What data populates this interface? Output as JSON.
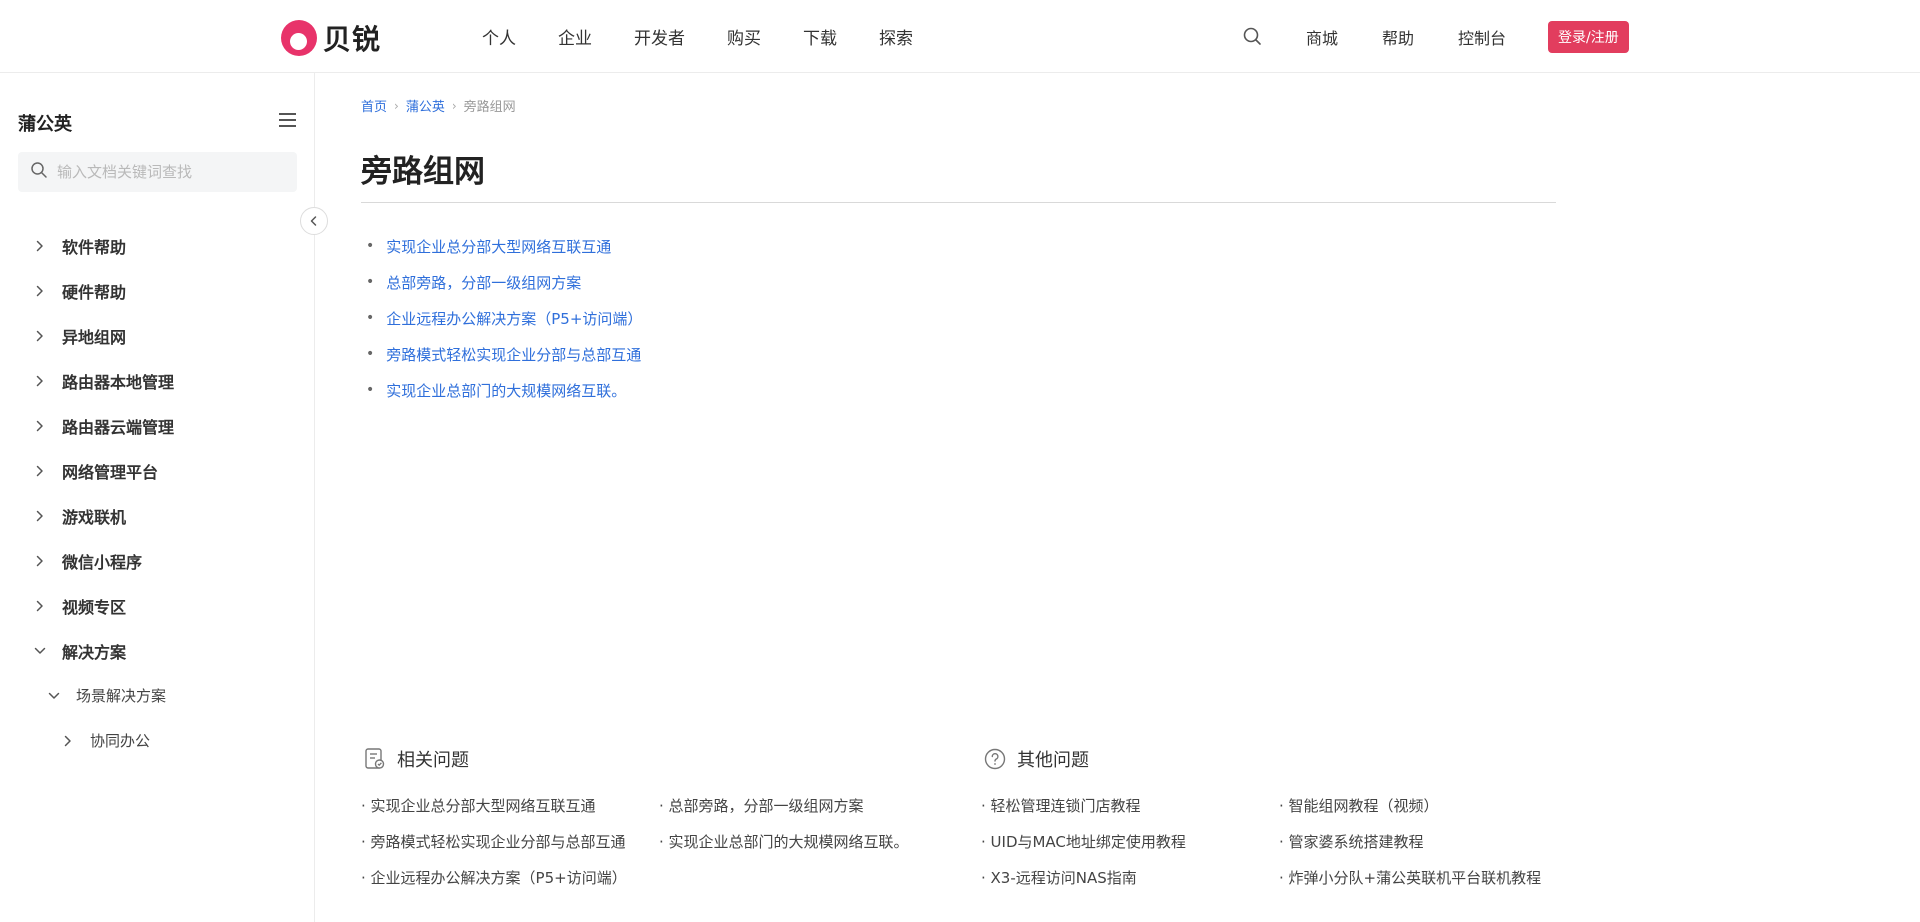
{
  "brand": {
    "name": "贝锐",
    "color": "#e8336a"
  },
  "nav": {
    "items": [
      "个人",
      "企业",
      "开发者",
      "购买",
      "下载",
      "探索"
    ],
    "right": [
      "商城",
      "帮助",
      "控制台"
    ],
    "login": "登录/注册",
    "login_color": "#e23d5e"
  },
  "sidebar": {
    "title": "蒲公英",
    "search_placeholder": "输入文档关键词查找",
    "tree": [
      {
        "label": "软件帮助",
        "level": 0,
        "expanded": false
      },
      {
        "label": "硬件帮助",
        "level": 0,
        "expanded": false
      },
      {
        "label": "异地组网",
        "level": 0,
        "expanded": false
      },
      {
        "label": "路由器本地管理",
        "level": 0,
        "expanded": false
      },
      {
        "label": "路由器云端管理",
        "level": 0,
        "expanded": false
      },
      {
        "label": "网络管理平台",
        "level": 0,
        "expanded": false
      },
      {
        "label": "游戏联机",
        "level": 0,
        "expanded": false
      },
      {
        "label": "微信小程序",
        "level": 0,
        "expanded": false
      },
      {
        "label": "视频专区",
        "level": 0,
        "expanded": false
      },
      {
        "label": "解决方案",
        "level": 0,
        "expanded": true
      },
      {
        "label": "场景解决方案",
        "level": 1,
        "expanded": true
      },
      {
        "label": "协同办公",
        "level": 2,
        "expanded": false
      }
    ]
  },
  "breadcrumb": {
    "home": "首页",
    "parent": "蒲公英",
    "current": "旁路组网"
  },
  "page": {
    "title": "旁路组网",
    "links": [
      "实现企业总分部大型网络互联互通",
      "总部旁路，分部一级组网方案",
      "企业远程办公解决方案（P5+访问端）",
      "旁路模式轻松实现企业分部与总部互通",
      "实现企业总部门的大规模网络互联。"
    ],
    "link_color": "#2f6fdb"
  },
  "related": {
    "title": "相关问题",
    "items": [
      "· 实现企业总分部大型网络互联互通",
      "· 总部旁路，分部一级组网方案",
      "· 旁路模式轻松实现企业分部与总部互通",
      "· 实现企业总部门的大规模网络互联。",
      "· 企业远程办公解决方案（P5+访问端）"
    ]
  },
  "other": {
    "title": "其他问题",
    "items": [
      "· 轻松管理连锁门店教程",
      "· 智能组网教程（视频）",
      "· UID与MAC地址绑定使用教程",
      "· 管家婆系统搭建教程",
      "· X3-远程访问NAS指南",
      "· 炸弹小分队+蒲公英联机平台联机教程"
    ]
  }
}
